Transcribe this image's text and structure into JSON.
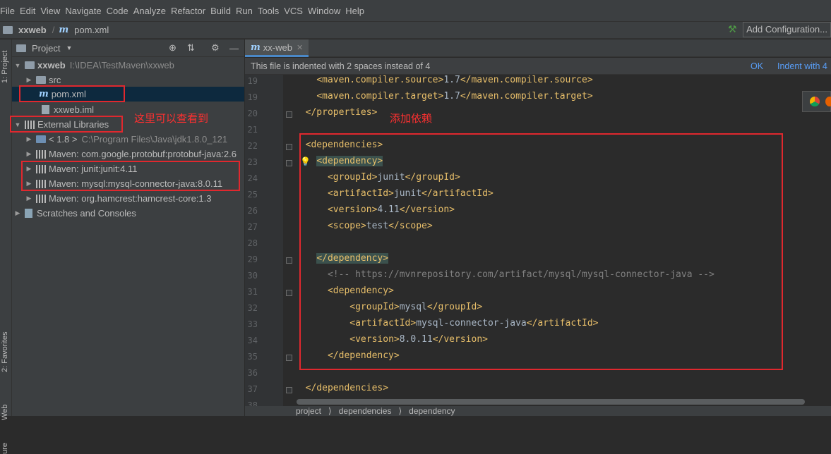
{
  "menu": [
    "File",
    "Edit",
    "View",
    "Navigate",
    "Code",
    "Analyze",
    "Refactor",
    "Build",
    "Run",
    "Tools",
    "VCS",
    "Window",
    "Help"
  ],
  "breadcrumb": {
    "project": "xxweb",
    "file": "pom.xml"
  },
  "toolbar": {
    "add_configuration": "Add Configuration..."
  },
  "left_strip": {
    "project_tab": "1: Project",
    "favorites_tab": "2: Favorites",
    "web_tab": "Web",
    "structure_tab": "ure"
  },
  "project_panel": {
    "title": "Project",
    "tree": [
      {
        "label": "xxweb",
        "detail": "I:\\IDEA\\TestMaven\\xxweb"
      },
      {
        "label": "src"
      },
      {
        "label": "pom.xml"
      },
      {
        "label": "xxweb.iml"
      },
      {
        "label": "External Libraries"
      },
      {
        "label": "< 1.8 >",
        "detail": "C:\\Program Files\\Java\\jdk1.8.0_121"
      },
      {
        "label": "Maven: com.google.protobuf:protobuf-java:2.6"
      },
      {
        "label": "Maven: junit:junit:4.11"
      },
      {
        "label": "Maven: mysql:mysql-connector-java:8.0.11"
      },
      {
        "label": "Maven: org.hamcrest:hamcrest-core:1.3"
      },
      {
        "label": "Scratches and Consoles"
      }
    ]
  },
  "annotations": {
    "see_here": "这里可以查看到",
    "add_dependency": "添加依赖"
  },
  "editor": {
    "tab": "xx-web",
    "banner": {
      "message": "This file is indented with 2 spaces instead of 4",
      "ok": "OK",
      "indent": "Indent with 4"
    },
    "lines": [
      {
        "num": "19",
        "text": "    <maven.compiler.source>1.7</maven.compiler.source>"
      },
      {
        "num": "19",
        "text": "    <maven.compiler.target>1.7</maven.compiler.target>"
      },
      {
        "num": "20",
        "text": "  </properties>"
      },
      {
        "num": "21",
        "text": ""
      },
      {
        "num": "22",
        "text": "  <dependencies>"
      },
      {
        "num": "23",
        "text": "    <dependency>"
      },
      {
        "num": "24",
        "text": "      <groupId>junit</groupId>"
      },
      {
        "num": "25",
        "text": "      <artifactId>junit</artifactId>"
      },
      {
        "num": "26",
        "text": "      <version>4.11</version>"
      },
      {
        "num": "27",
        "text": "      <scope>test</scope>"
      },
      {
        "num": "28",
        "text": ""
      },
      {
        "num": "29",
        "text": "    </dependency>"
      },
      {
        "num": "30",
        "text": "      <!-- https://mvnrepository.com/artifact/mysql/mysql-connector-java -->"
      },
      {
        "num": "31",
        "text": "      <dependency>"
      },
      {
        "num": "32",
        "text": "          <groupId>mysql</groupId>"
      },
      {
        "num": "33",
        "text": "          <artifactId>mysql-connector-java</artifactId>"
      },
      {
        "num": "34",
        "text": "          <version>8.0.11</version>"
      },
      {
        "num": "35",
        "text": "      </dependency>"
      },
      {
        "num": "36",
        "text": ""
      },
      {
        "num": "37",
        "text": "  </dependencies>"
      },
      {
        "num": "38",
        "text": ""
      }
    ],
    "status_path": [
      "project",
      "dependencies",
      "dependency"
    ]
  }
}
